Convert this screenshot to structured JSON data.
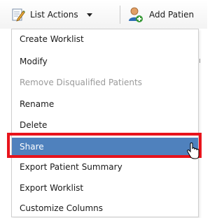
{
  "toolbar": {
    "list_actions_label": "List Actions",
    "add_patient_label": "Add Patien",
    "list_actions_icon": "edit-list-icon",
    "add_patient_icon": "add-person-icon",
    "dropdown_icon": "caret-down-icon"
  },
  "menu": {
    "items": [
      {
        "label": "Create Worklist",
        "state": "enabled"
      },
      {
        "label": "Modify",
        "state": "enabled"
      },
      {
        "label": "Remove Disqualified Patients",
        "state": "disabled"
      },
      {
        "label": "Rename",
        "state": "enabled"
      },
      {
        "label": "Delete",
        "state": "enabled"
      },
      {
        "label": "Share",
        "state": "selected"
      },
      {
        "label": "Export Patient Summary",
        "state": "enabled"
      },
      {
        "label": "Export Worklist",
        "state": "enabled"
      },
      {
        "label": "Customize Columns",
        "state": "enabled"
      }
    ]
  },
  "colors": {
    "selected_bg": "#4f81bd",
    "highlight_border": "#e8141c",
    "disabled_text": "#9a9a9a"
  }
}
